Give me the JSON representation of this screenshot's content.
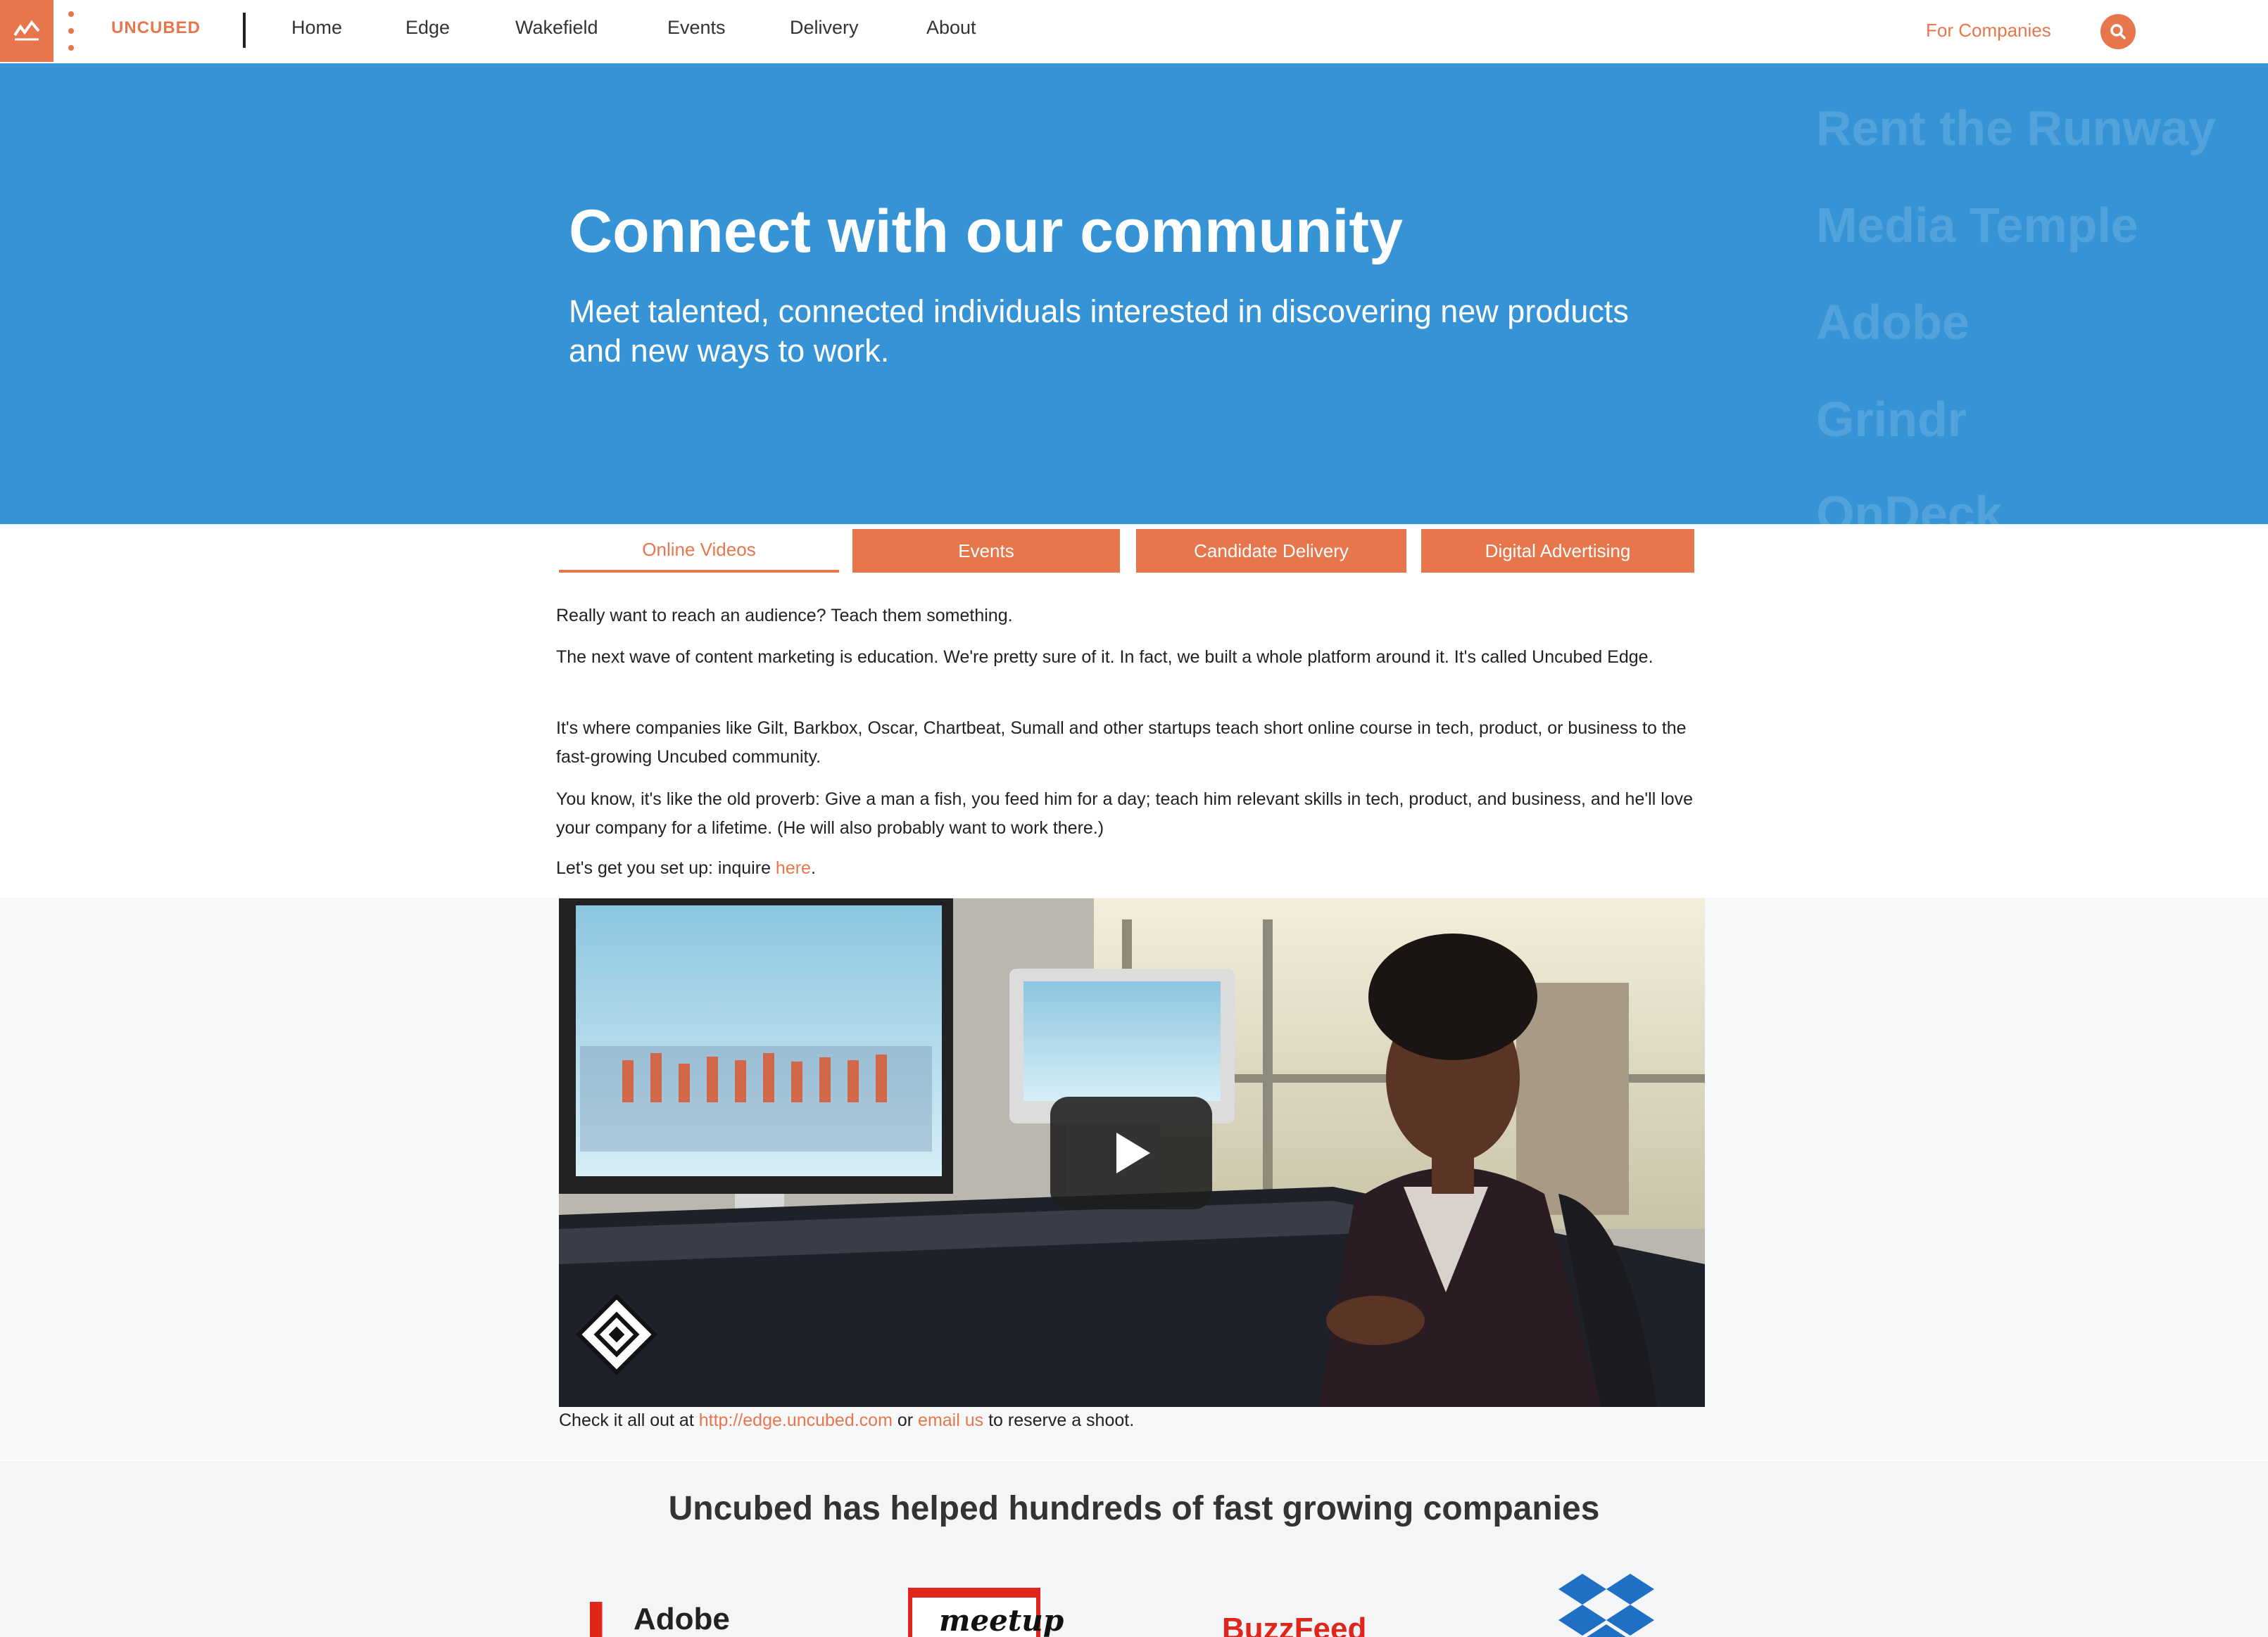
{
  "nav": {
    "brand": "UNCUBED",
    "links": [
      "Home",
      "Edge",
      "Wakefield",
      "Events",
      "Delivery",
      "About"
    ],
    "for_companies": "For Companies"
  },
  "hero": {
    "title": "Connect with our community",
    "subtitle": "Meet talented, connected individuals interested in discovering new products and new ways to work.",
    "ghost_companies": [
      "Rent the Runway",
      "Media Temple",
      "Adobe",
      "Grindr",
      "OnDeck"
    ]
  },
  "tabs": [
    "Online Videos",
    "Events",
    "Candidate Delivery",
    "Digital Advertising"
  ],
  "content": {
    "p1": "Really want to reach an audience? Teach them something.",
    "p2": "The next wave of content marketing is education. We're pretty sure of it. In fact, we built a whole platform around it. It's called Uncubed Edge.",
    "p3": "It's where companies like Gilt, Barkbox, Oscar, Chartbeat, Sumall and other startups teach short online course in tech, product, or business to the fast-growing Uncubed community.",
    "p4": "You know, it's like the old proverb: Give a man a fish, you feed him for a day; teach him relevant skills in tech, product, and business, and he'll love your company for a lifetime. (He will also probably want to work there.)",
    "p5_prefix": "Let's get you set up: inquire ",
    "p5_link": "here",
    "p5_suffix": "."
  },
  "caption": {
    "prefix": "Check it all out at ",
    "url": "http://edge.uncubed.com",
    "middle": " or ",
    "email_link": "email us",
    "suffix": " to reserve a shoot."
  },
  "companies": {
    "title": "Uncubed has helped hundreds of fast growing companies",
    "logos": {
      "adobe": "Adobe",
      "meetup": "meetup",
      "buzzfeed": "BuzzFeed"
    }
  },
  "colors": {
    "accent": "#e8764c",
    "hero_blue": "#3694d6"
  }
}
